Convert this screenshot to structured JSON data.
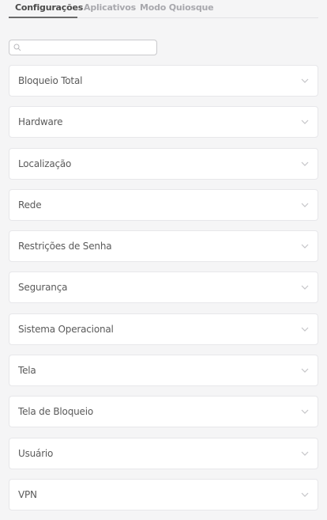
{
  "tabs": [
    {
      "label": "Configurações",
      "active": true
    },
    {
      "label": "Aplicativos",
      "active": false
    },
    {
      "label": "Modo Quiosque",
      "active": false
    }
  ],
  "search": {
    "value": "",
    "placeholder": "",
    "icon": "search-icon"
  },
  "sections": [
    {
      "label": "Bloqueio Total"
    },
    {
      "label": "Hardware"
    },
    {
      "label": "Localização"
    },
    {
      "label": "Rede"
    },
    {
      "label": "Restrições de Senha"
    },
    {
      "label": "Segurança"
    },
    {
      "label": "Sistema Operacional"
    },
    {
      "label": "Tela"
    },
    {
      "label": "Tela de Bloqueio"
    },
    {
      "label": "Usuário"
    },
    {
      "label": "VPN"
    }
  ],
  "icons": {
    "expand": "chevron-down-icon"
  },
  "colors": {
    "background": "#f5f5f6",
    "active_tab": "#4a4a4a",
    "inactive_tab": "#a8a8ad",
    "card": "#ffffff"
  }
}
